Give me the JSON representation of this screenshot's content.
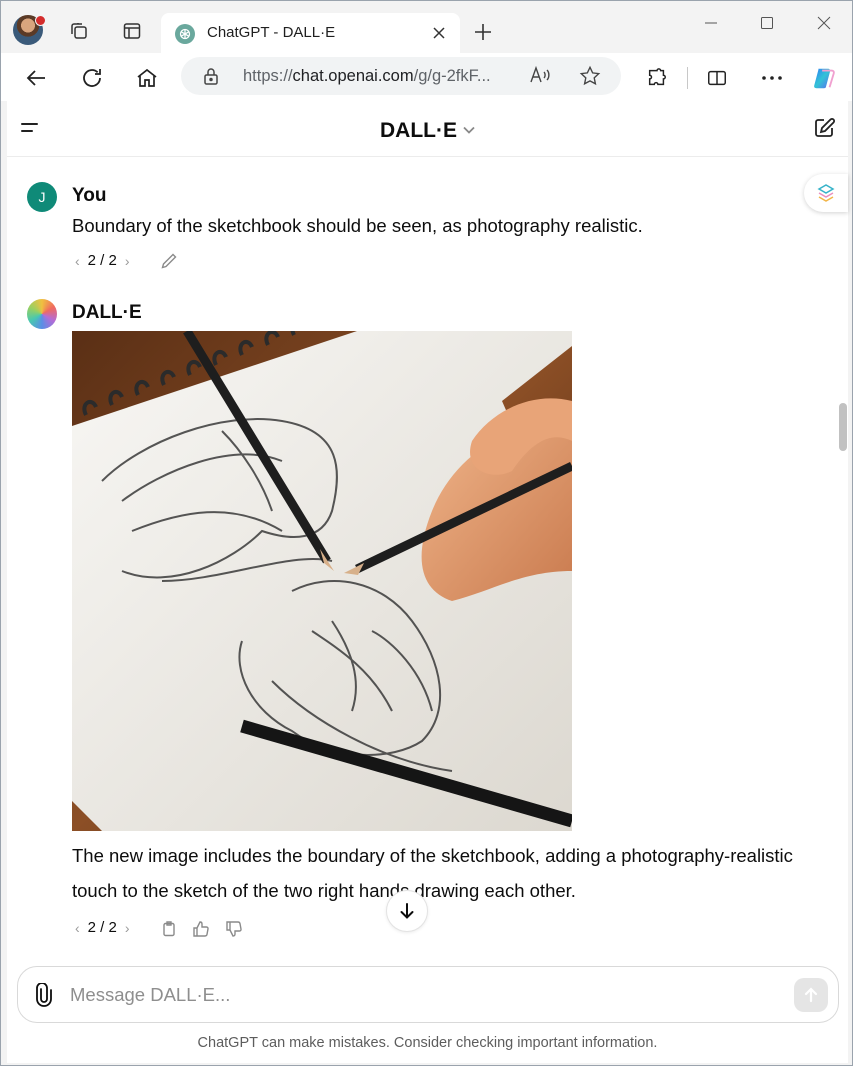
{
  "browser": {
    "tab": {
      "title": "ChatGPT - DALL·E"
    },
    "url": {
      "scheme_prefix": "https://",
      "host": "chat.openai.com",
      "path": "/g/g-2fkF..."
    },
    "read_aloud_label": "Ắ"
  },
  "header": {
    "title": "DALL·E"
  },
  "conversation": {
    "user": {
      "avatar_initial": "J",
      "name": "You",
      "text": "Boundary of the sketchbook should be seen, as photography realistic.",
      "pager": "2 / 2"
    },
    "assistant": {
      "name": "DALL·E",
      "text": "The new image includes the boundary of the sketchbook, adding a photography-realistic touch to the sketch of the two right hands drawing each other.",
      "pager": "2 / 2"
    }
  },
  "composer": {
    "placeholder": "Message DALL·E..."
  },
  "footer": {
    "note": "ChatGPT can make mistakes. Consider checking important information."
  },
  "colors": {
    "user_avatar": "#0f8a78",
    "page_bg": "#ffffff",
    "chrome_bg": "#f3f3f3"
  }
}
